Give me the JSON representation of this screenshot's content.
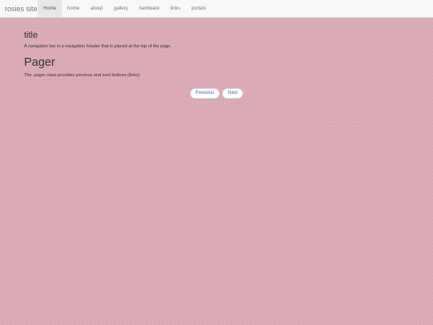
{
  "navbar": {
    "brand": "rosies site",
    "items": [
      {
        "label": "Home",
        "active": true
      },
      {
        "label": "home",
        "active": false
      },
      {
        "label": "about",
        "active": false
      },
      {
        "label": "gallery",
        "active": false
      },
      {
        "label": "hardware",
        "active": false
      },
      {
        "label": "links",
        "active": false
      },
      {
        "label": "portals",
        "active": false
      }
    ]
  },
  "main": {
    "title": "title",
    "title_text": "A navigation bar is a navigation header that is placed at the top of the page.",
    "pager_heading": "Pager",
    "pager_text": "The .pager class provides previous and next buttons (links):"
  },
  "pager": {
    "previous_label": "Previous",
    "next_label": "Next"
  },
  "colors": {
    "background": "#dba9b6",
    "navbar": "#f8f8f8",
    "link": "#337ab7"
  }
}
